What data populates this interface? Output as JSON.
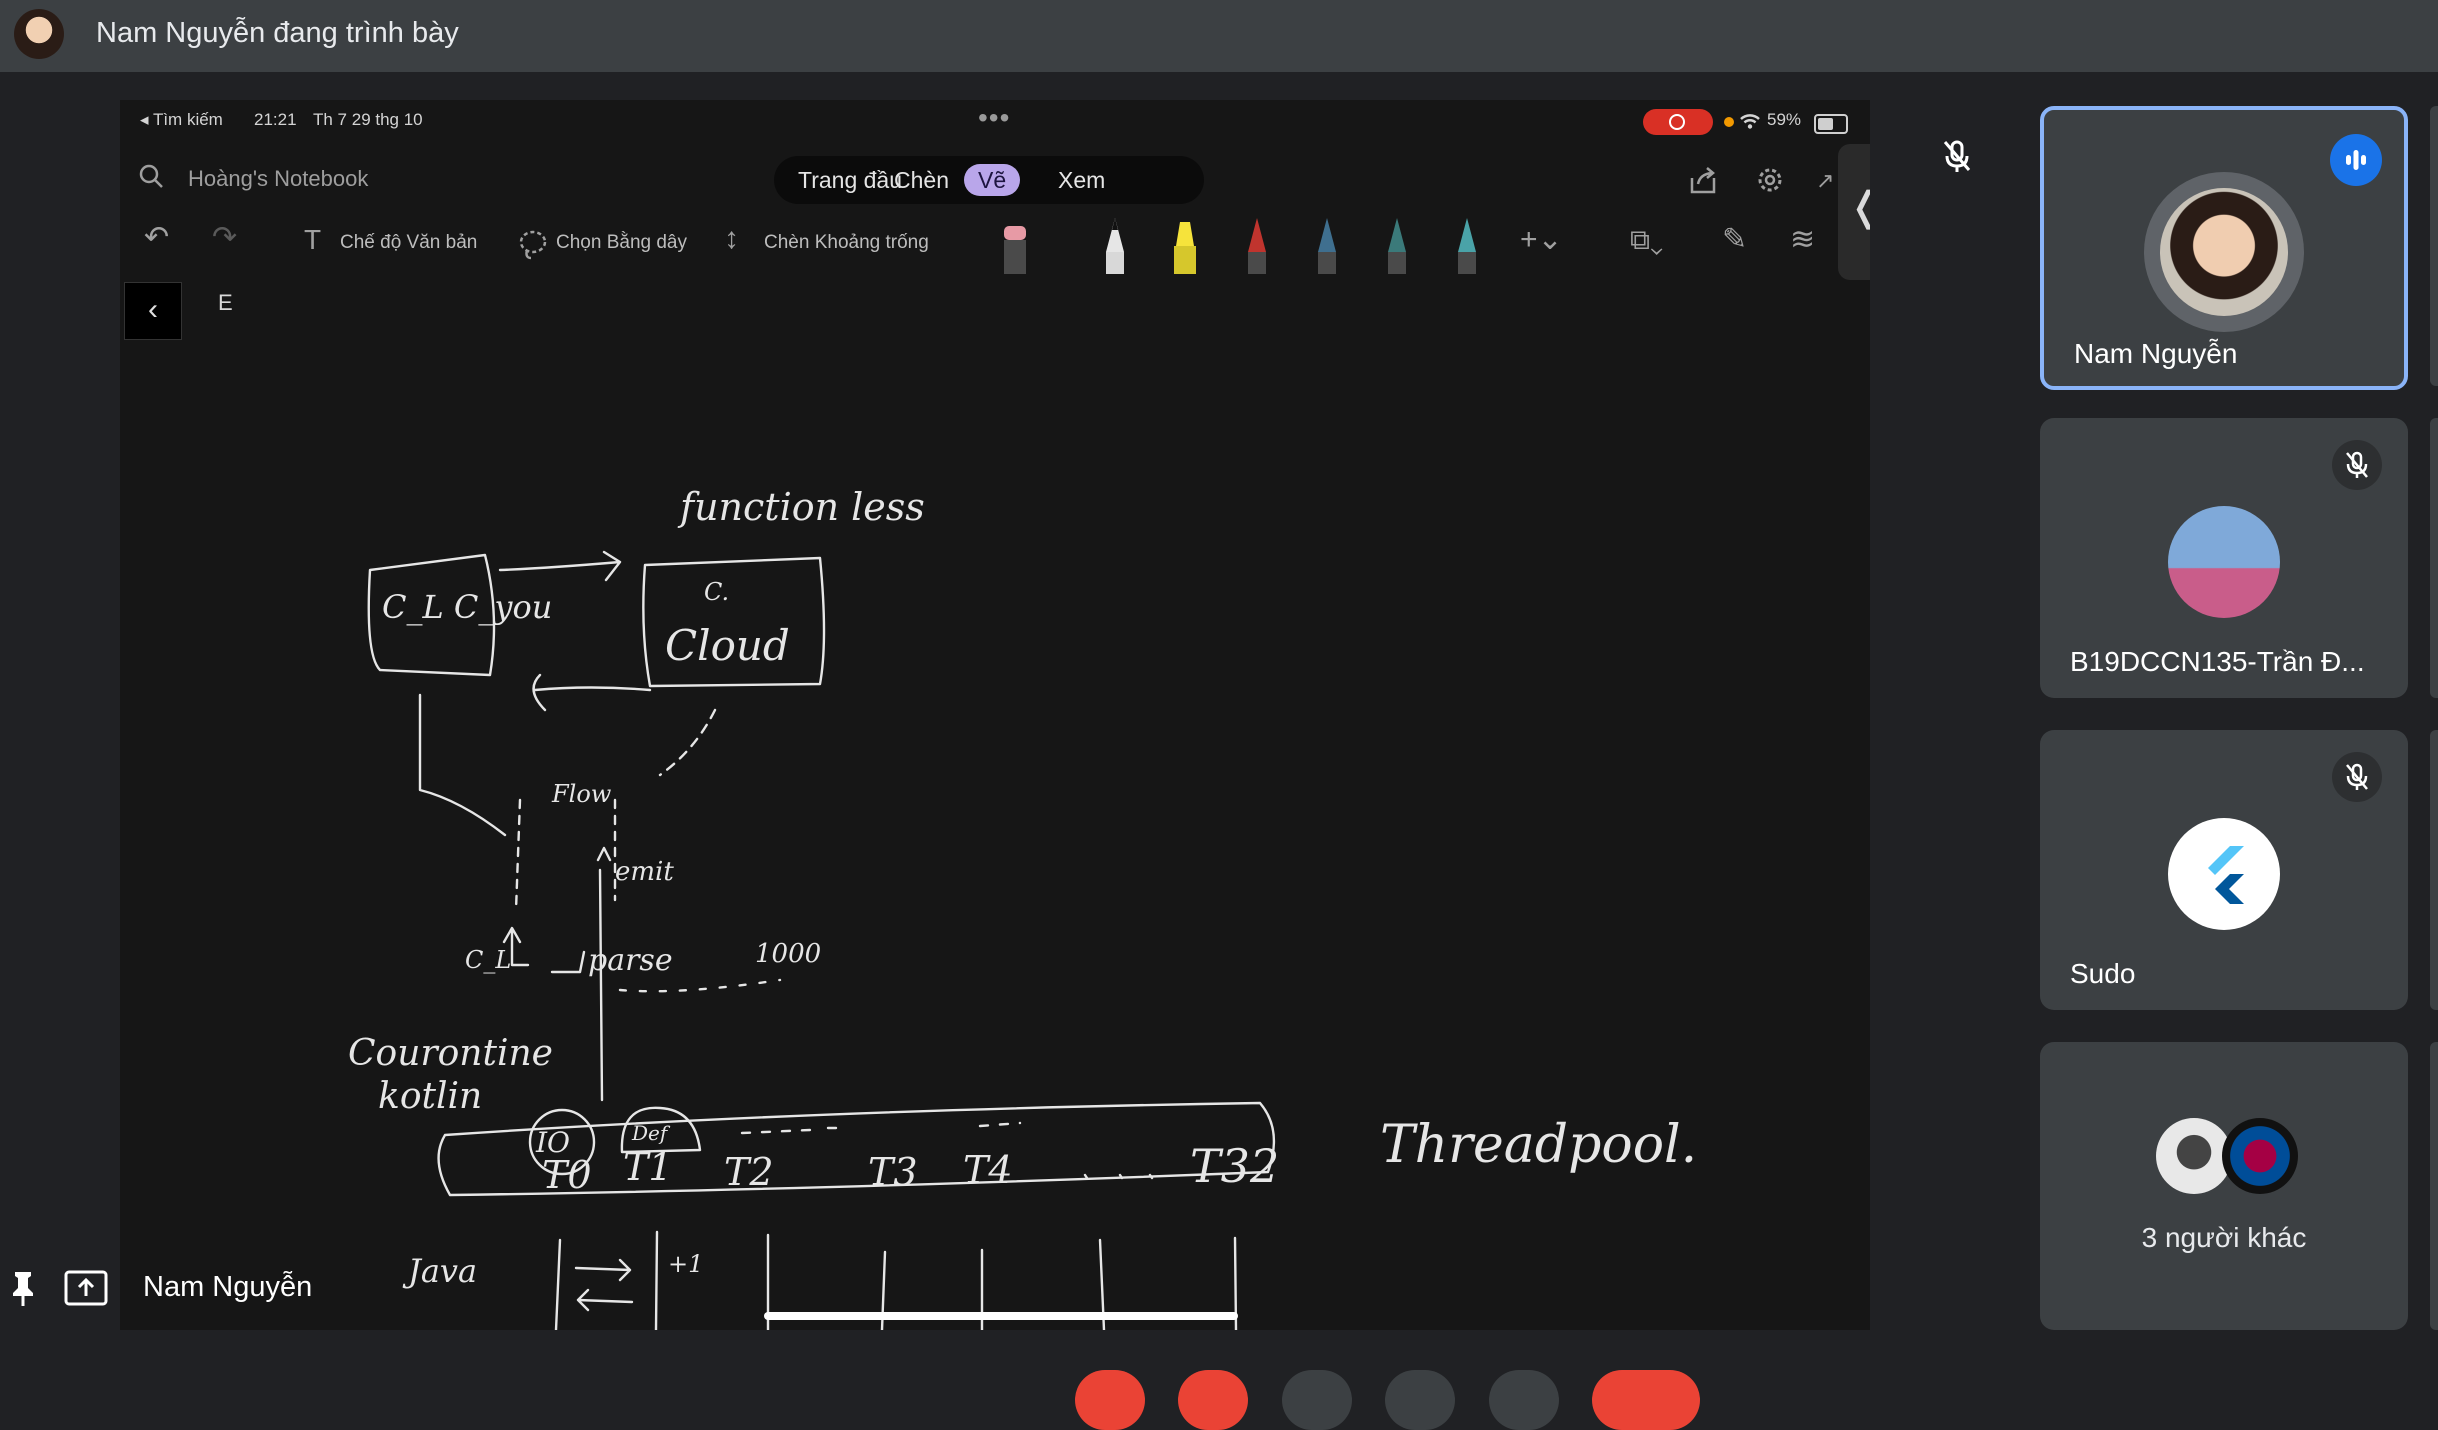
{
  "topbar": {
    "presenting_text": "Nam Nguyễn đang trình bày"
  },
  "share": {
    "status": {
      "back_app": "◂ Tìm kiếm",
      "time": "21:21",
      "date": "Th 7 29 thg 10",
      "battery": "59%"
    },
    "notebook_title": "Hoàng's Notebook",
    "tabs": [
      {
        "label": "Trang đầu",
        "active": false
      },
      {
        "label": "Chèn",
        "active": false
      },
      {
        "label": "Vẽ",
        "active": true
      },
      {
        "label": "Xem",
        "active": false
      }
    ],
    "toolbar": {
      "text_mode": "Chế độ Văn bản",
      "lasso_select": "Chọn Bằng dây",
      "insert_space": "Chèn Khoảng trống"
    },
    "page_letter": "E",
    "drawing": {
      "top_label": "function less",
      "box1": "C_L C_you",
      "box2_top": "C.",
      "box2": "Cloud",
      "flow": "Flow",
      "emit": "emit",
      "cl": "C_L",
      "parse": "parse",
      "num": "1000",
      "coroutine": "Courontine",
      "kotlin": "kotlin",
      "io": "IO",
      "default": "Def",
      "threads": [
        "T0",
        "T1",
        "T2",
        "T3",
        "T4",
        "T32"
      ],
      "threadpool": "Threadpool.",
      "java": "Java",
      "plus1": "+1"
    }
  },
  "presenter_label": "Nam Nguyễn",
  "participants": [
    {
      "name": "Nam Nguyễn",
      "speaking": true,
      "muted": false
    },
    {
      "name": "B19DCCN135-Trần Đ...",
      "speaking": false,
      "muted": true
    },
    {
      "name": "Sudo",
      "speaking": false,
      "muted": true
    }
  ],
  "others_label": "3 người khác",
  "colors": {
    "topbar": "#3c4043",
    "tile": "#3c4043",
    "accent": "#8ab4f8",
    "speaking": "#1a73e8",
    "record": "#d93025",
    "tab_active": "#b9a6ea"
  }
}
